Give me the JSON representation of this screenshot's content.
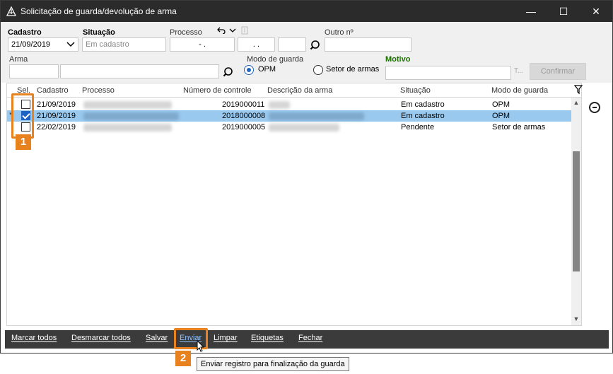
{
  "window": {
    "title": "Solicitação de guarda/devolução de arma",
    "controls": {
      "minimize": "—",
      "maximize": "☐",
      "close": "✕"
    }
  },
  "form": {
    "cadastro_label": "Cadastro",
    "cadastro_value": "21/09/2019",
    "situacao_label": "Situação",
    "situacao_placeholder": "Em cadastro",
    "processo_label": "Processo",
    "processo_part1": "- .",
    "processo_part2": ". .",
    "processo_part3": "",
    "outro_label": "Outro nº",
    "outro_value": "",
    "arma_label": "Arma",
    "arma_code": "",
    "arma_desc": "",
    "modo_label": "Modo de guarda",
    "modo_options": [
      "OPM",
      "Setor de armas"
    ],
    "modo_selected": "OPM",
    "motivo_label": "Motivo",
    "motivo_value": "",
    "motivo_ellipsis": "T...",
    "confirm_label": "Confirmar"
  },
  "grid": {
    "columns": [
      "Sel.",
      "Cadastro",
      "Processo",
      "Número de controle",
      "Descrição da arma",
      "Situação",
      "Modo de guarda"
    ],
    "rows": [
      {
        "marker": "",
        "checked": false,
        "cadastro": "21/09/2019",
        "controle": "2019000011",
        "situacao": "Em cadastro",
        "modo": "OPM",
        "selected": false
      },
      {
        "marker": "*",
        "checked": true,
        "cadastro": "21/09/2019",
        "controle": "2018000008",
        "situacao": "Em cadastro",
        "modo": "OPM",
        "selected": true
      },
      {
        "marker": "",
        "checked": false,
        "cadastro": "22/02/2019",
        "controle": "2019000005",
        "situacao": "Pendente",
        "modo": "Setor de armas",
        "selected": false
      }
    ]
  },
  "toolbar": {
    "marcar_todos": "Marcar todos",
    "desmarcar_todos": "Desmarcar todos",
    "salvar": "Salvar",
    "enviar": "Enviar",
    "limpar": "Limpar",
    "etiquetas": "Etiquetas",
    "fechar": "Fechar"
  },
  "annotations": {
    "badge1": "1",
    "badge2": "2",
    "accent": "#e8821e"
  },
  "tooltip": "Enviar registro para finalização da guarda"
}
